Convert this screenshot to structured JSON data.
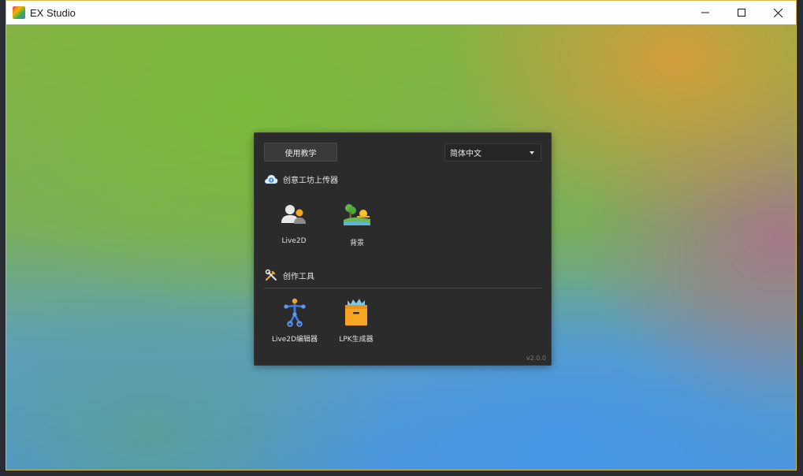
{
  "window": {
    "title": "EX Studio",
    "controls": {
      "minimize_icon": "minimize-icon",
      "maximize_icon": "maximize-icon",
      "close_icon": "close-icon"
    }
  },
  "panel": {
    "tutorial_label": "使用教学",
    "language": {
      "selected": "简体中文",
      "icon": "chevron-down-icon"
    },
    "sections": [
      {
        "title": "创意工坊上传器",
        "icon": "cloud-upload-icon",
        "items": [
          {
            "label": "Live2D",
            "icon": "users-icon"
          },
          {
            "label": "背景",
            "icon": "landscape-icon"
          }
        ]
      },
      {
        "title": "创作工具",
        "icon": "tools-icon",
        "items": [
          {
            "label": "Live2D编辑器",
            "icon": "rig-figure-icon"
          },
          {
            "label": "LPK生成器",
            "icon": "package-box-icon"
          }
        ]
      }
    ],
    "version": "v2.0.0"
  },
  "colors": {
    "panel_bg": "#2b2b2b",
    "accent_orange": "#f6a623",
    "accent_blue": "#3a7be0",
    "title_border": "#d9b84a"
  }
}
